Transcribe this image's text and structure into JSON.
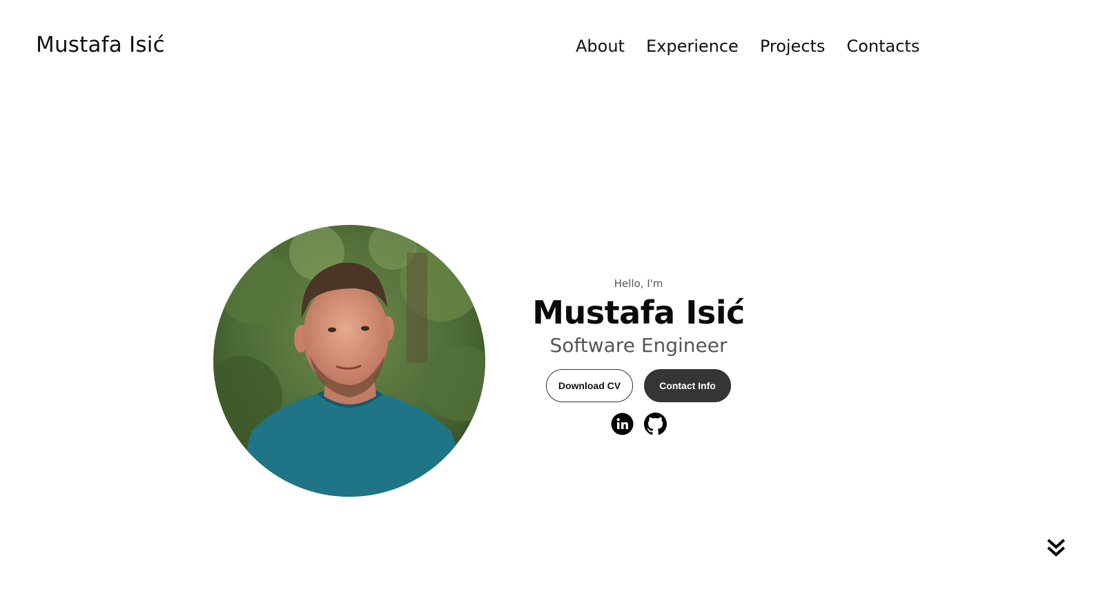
{
  "header": {
    "brand": "Mustafa Isić",
    "nav": [
      {
        "label": "About"
      },
      {
        "label": "Experience"
      },
      {
        "label": "Projects"
      },
      {
        "label": "Contacts"
      }
    ]
  },
  "hero": {
    "greeting": "Hello, I'm",
    "name": "Mustafa Isić",
    "role": "Software Engineer",
    "buttons": {
      "download_cv": "Download CV",
      "contact_info": "Contact Info"
    },
    "socials": [
      "linkedin-icon",
      "github-icon"
    ]
  },
  "scroll": {
    "icon": "double-chevron-down-icon"
  },
  "colors": {
    "text": "#111111",
    "muted": "#555555",
    "button_dark": "#353535",
    "background": "#ffffff"
  }
}
